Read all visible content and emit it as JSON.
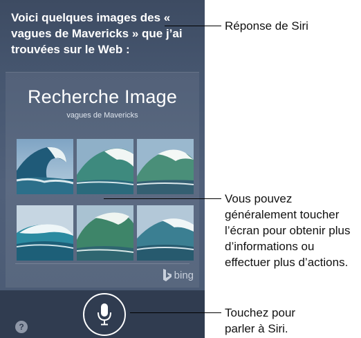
{
  "siri_response": "Voici quelques images des « vagues de  Mavericks » que j’ai trouvées sur le Web :",
  "card": {
    "title": "Recherche Image",
    "subtitle": "vagues de Mavericks",
    "provider": "bing",
    "images": [
      {
        "icon": "wave-image"
      },
      {
        "icon": "wave-image"
      },
      {
        "icon": "wave-image"
      },
      {
        "icon": "wave-image"
      },
      {
        "icon": "wave-image"
      },
      {
        "icon": "wave-image"
      }
    ]
  },
  "buttons": {
    "mic_icon": "microphone-icon",
    "help_label": "?"
  },
  "callouts": {
    "response": "Réponse de Siri",
    "tap_screen": "Vous pouvez généralement toucher l’écran pour obtenir plus d’informations ou effectuer plus d’actions.",
    "tap_mic": "Touchez pour parler à Siri."
  },
  "colors": {
    "background": "#46566f",
    "bottom_bar": "#303c50",
    "text": "#ffffff",
    "callout_text": "#111111"
  }
}
